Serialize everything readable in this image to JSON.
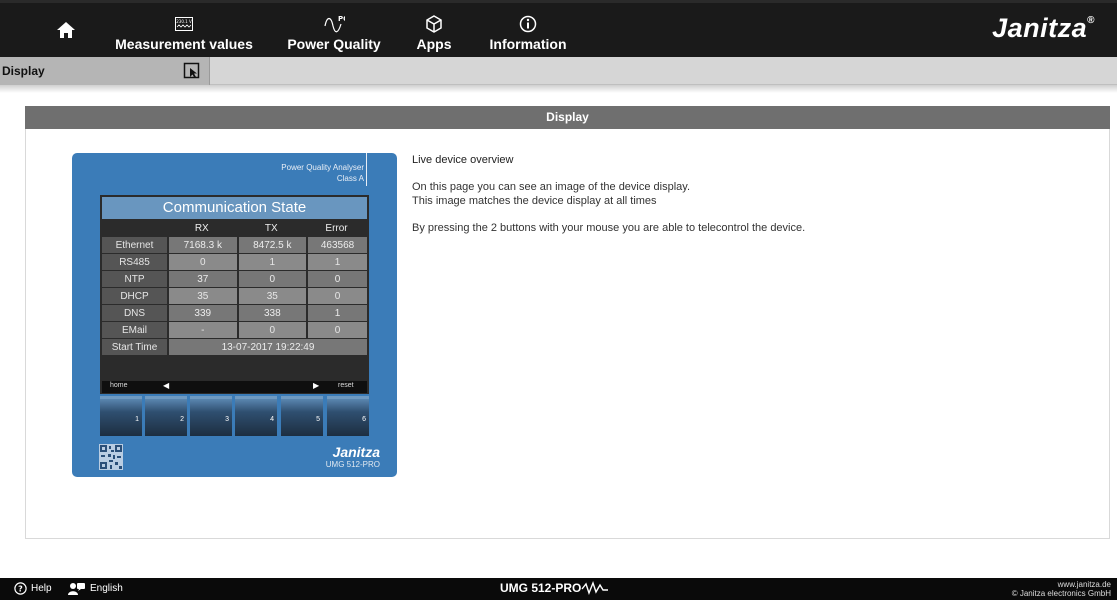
{
  "brand": {
    "name": "Janitza",
    "reg": "®"
  },
  "nav": {
    "items": [
      {
        "label": "Measurement values",
        "icon": "measurement-icon"
      },
      {
        "label": "Power Quality",
        "icon": "pq-icon"
      },
      {
        "label": "Apps",
        "icon": "apps-icon"
      },
      {
        "label": "Information",
        "icon": "info-icon"
      }
    ],
    "pq_icon_text": "PQ",
    "meas_icon_text": "230.1 V"
  },
  "subnav": {
    "active_tab": "Display"
  },
  "panel": {
    "title": "Display"
  },
  "device": {
    "model_text_line1": "Power Quality Analyser",
    "model_text_line2": "Class A",
    "screen_title": "Communication State",
    "columns": [
      "",
      "RX",
      "TX",
      "Error"
    ],
    "rows": [
      {
        "label": "Ethernet",
        "rx": "7168.3 k",
        "tx": "8472.5 k",
        "error": "463568"
      },
      {
        "label": "RS485",
        "rx": "0",
        "tx": "1",
        "error": "1"
      },
      {
        "label": "NTP",
        "rx": "37",
        "tx": "0",
        "error": "0"
      },
      {
        "label": "DHCP",
        "rx": "35",
        "tx": "35",
        "error": "0"
      },
      {
        "label": "DNS",
        "rx": "339",
        "tx": "338",
        "error": "1"
      },
      {
        "label": "EMail",
        "rx": "-",
        "tx": "0",
        "error": "0"
      }
    ],
    "start_time_label": "Start Time",
    "start_time_value": "13-07-2017  19:22:49",
    "nav_home": "home",
    "nav_reset": "reset",
    "keys": [
      "1",
      "2",
      "3",
      "4",
      "5",
      "6"
    ],
    "brand": "Janitza",
    "model": "UMG 512-PRO"
  },
  "info": {
    "heading": "Live device overview",
    "line1": "On this page you can see an image of the device display.",
    "line2": "This image matches the device display at all times",
    "line3": "By pressing the 2 buttons with your mouse you are able to telecontrol the device."
  },
  "footer": {
    "help": "Help",
    "language": "English",
    "model": "UMG 512-PRO",
    "website": "www.janitza.de",
    "copyright": "© Janitza electronics GmbH"
  },
  "colors": {
    "topnav": "#1a1a1a",
    "device_blue": "#3b7cb8",
    "panel_header": "#6f6f6f",
    "screen_title": "#6996bf"
  }
}
